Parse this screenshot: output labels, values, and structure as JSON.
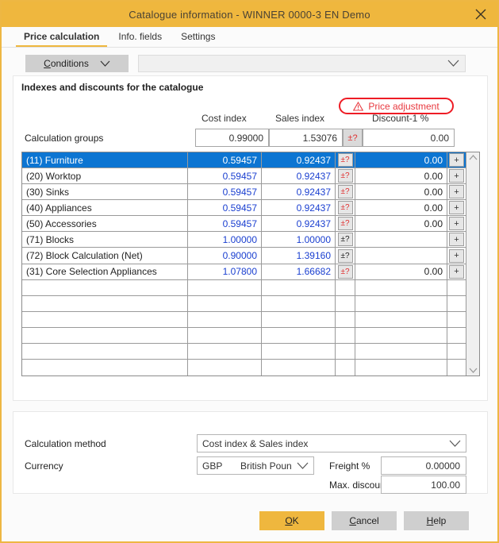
{
  "window": {
    "title": "Catalogue information - WINNER 0000-3 EN Demo",
    "close_icon": "close-icon",
    "accent_color": "#efb73e",
    "selection_color": "#0c75d2",
    "warning_color": "#ee1c25"
  },
  "tabs": [
    {
      "label": "Price calculation",
      "active": true
    },
    {
      "label": "Info. fields",
      "active": false
    },
    {
      "label": "Settings",
      "active": false
    }
  ],
  "conditions": {
    "button_mnemonic": "C",
    "button_label_rest": "onditions",
    "dropdown_value": "",
    "chevron_icon": "chevron-down-icon"
  },
  "indexes_panel": {
    "title": "Indexes and discounts for the catalogue",
    "warning_badge": {
      "label": "Price adjustment",
      "icon": "warning-triangle-icon"
    },
    "column_headers": {
      "cost_index": "Cost index",
      "sales_index": "Sales index",
      "discount1": "Discount-1 %"
    },
    "calculation_groups": {
      "label": "Calculation groups",
      "cost_index": "0.99000",
      "sales_index": "1.53076",
      "plusminus": "±?",
      "discount1": "0.00"
    },
    "rows": [
      {
        "name": "(11) Furniture",
        "cost_index": "0.59457",
        "sales_index": "0.92437",
        "plusminus": "±?",
        "pm_red": true,
        "discount1": "0.00",
        "plus": "+",
        "selected": true
      },
      {
        "name": "(20) Worktop",
        "cost_index": "0.59457",
        "sales_index": "0.92437",
        "plusminus": "±?",
        "pm_red": true,
        "discount1": "0.00",
        "plus": "+",
        "selected": false
      },
      {
        "name": "(30) Sinks",
        "cost_index": "0.59457",
        "sales_index": "0.92437",
        "plusminus": "±?",
        "pm_red": true,
        "discount1": "0.00",
        "plus": "+",
        "selected": false
      },
      {
        "name": "(40) Appliances",
        "cost_index": "0.59457",
        "sales_index": "0.92437",
        "plusminus": "±?",
        "pm_red": true,
        "discount1": "0.00",
        "plus": "+",
        "selected": false
      },
      {
        "name": "(50) Accessories",
        "cost_index": "0.59457",
        "sales_index": "0.92437",
        "plusminus": "±?",
        "pm_red": true,
        "discount1": "0.00",
        "plus": "+",
        "selected": false
      },
      {
        "name": "(71) Blocks",
        "cost_index": "1.00000",
        "sales_index": "1.00000",
        "plusminus": "±?",
        "pm_red": false,
        "discount1": "",
        "plus": "+",
        "selected": false
      },
      {
        "name": "(72) Block Calculation (Net)",
        "cost_index": "0.90000",
        "sales_index": "1.39160",
        "plusminus": "±?",
        "pm_red": false,
        "discount1": "",
        "plus": "+",
        "selected": false
      },
      {
        "name": "(31) Core Selection Appliances",
        "cost_index": "1.07800",
        "sales_index": "1.66682",
        "plusminus": "±?",
        "pm_red": true,
        "discount1": "0.00",
        "plus": "+",
        "selected": false
      },
      {
        "name": "",
        "cost_index": "",
        "sales_index": "",
        "plusminus": "",
        "pm_red": false,
        "discount1": "",
        "plus": "",
        "selected": false
      },
      {
        "name": "",
        "cost_index": "",
        "sales_index": "",
        "plusminus": "",
        "pm_red": false,
        "discount1": "",
        "plus": "",
        "selected": false
      },
      {
        "name": "",
        "cost_index": "",
        "sales_index": "",
        "plusminus": "",
        "pm_red": false,
        "discount1": "",
        "plus": "",
        "selected": false
      },
      {
        "name": "",
        "cost_index": "",
        "sales_index": "",
        "plusminus": "",
        "pm_red": false,
        "discount1": "",
        "plus": "",
        "selected": false
      },
      {
        "name": "",
        "cost_index": "",
        "sales_index": "",
        "plusminus": "",
        "pm_red": false,
        "discount1": "",
        "plus": "",
        "selected": false
      },
      {
        "name": "",
        "cost_index": "",
        "sales_index": "",
        "plusminus": "",
        "pm_red": false,
        "discount1": "",
        "plus": "",
        "selected": false
      }
    ],
    "scrollbar": {
      "up_icon": "chevron-up-icon",
      "down_icon": "chevron-down-icon"
    }
  },
  "settings_panel": {
    "calculation_method_label": "Calculation method",
    "calculation_method_value": "Cost index & Sales index",
    "currency_label": "Currency",
    "currency_code": "GBP",
    "currency_name": "British Pounds",
    "freight_label": "Freight %",
    "freight_value": "0.00000",
    "max_discount_label": "Max. discount %",
    "max_discount_value": "100.00"
  },
  "footer": {
    "ok": {
      "mnemonic": "O",
      "rest": "K"
    },
    "cancel": {
      "mnemonic": "C",
      "rest": "ancel"
    },
    "help": {
      "mnemonic": "H",
      "rest": "elp"
    }
  }
}
